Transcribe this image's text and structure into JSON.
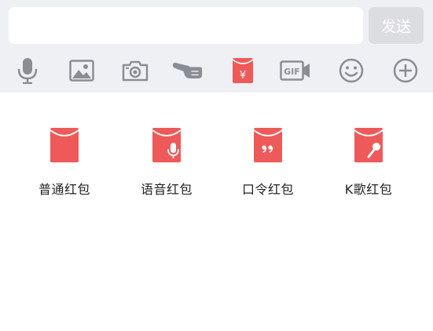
{
  "input": {
    "value": "",
    "placeholder": "",
    "send_label": "发送"
  },
  "toolbar": {
    "items": [
      {
        "name": "microphone-icon"
      },
      {
        "name": "image-icon"
      },
      {
        "name": "camera-icon"
      },
      {
        "name": "poke-hand-icon"
      },
      {
        "name": "red-packet-icon",
        "glyph": "¥"
      },
      {
        "name": "gif-icon",
        "label": "GIF"
      },
      {
        "name": "emoji-icon"
      },
      {
        "name": "plus-icon"
      }
    ]
  },
  "red_packets": {
    "items": [
      {
        "label": "普通红包",
        "icon": "red-packet-normal-icon"
      },
      {
        "label": "语音红包",
        "icon": "red-packet-voice-icon"
      },
      {
        "label": "口令红包",
        "icon": "red-packet-password-icon"
      },
      {
        "label": "K歌红包",
        "icon": "red-packet-karaoke-icon"
      }
    ]
  },
  "colors": {
    "accent_red": "#ee5a5a",
    "icon_gray": "#8a8d93",
    "toolbar_bg": "#eff0f4",
    "send_bg": "#dcdde1"
  }
}
